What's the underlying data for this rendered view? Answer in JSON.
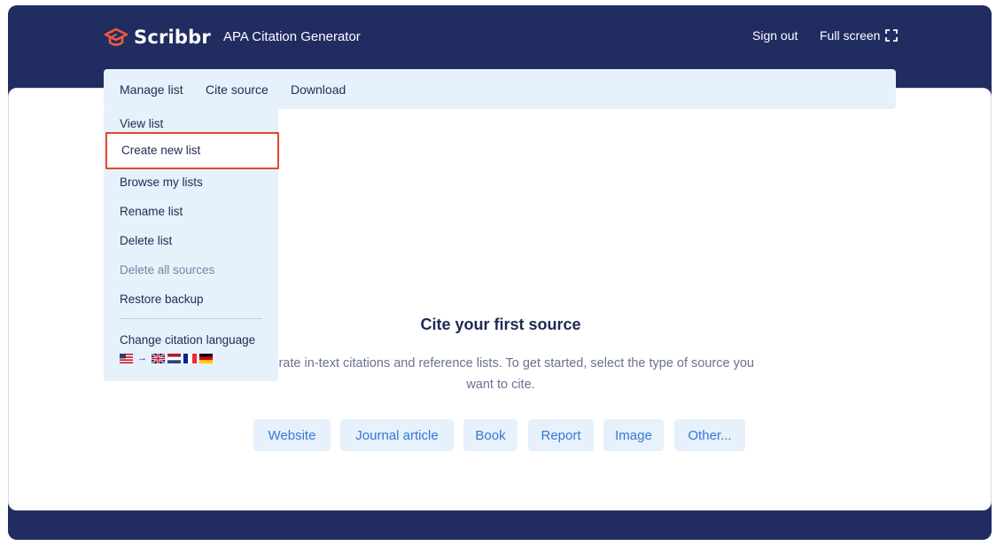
{
  "header": {
    "brand": "Scribbr",
    "app_title": "APA Citation Generator",
    "sign_out": "Sign out",
    "full_screen": "Full screen"
  },
  "toolbar": {
    "manage_list": "Manage list",
    "cite_source": "Cite source",
    "download": "Download"
  },
  "dropdown": {
    "items": [
      {
        "label": "View list"
      },
      {
        "label": "Create new list"
      },
      {
        "label": "Browse my lists"
      },
      {
        "label": "Rename list"
      },
      {
        "label": "Delete list"
      },
      {
        "label": "Delete all sources"
      },
      {
        "label": "Restore backup"
      }
    ],
    "language_label": "Change citation language",
    "flags": [
      "us-flag-icon",
      "arrow-right-icon",
      "uk-flag-icon",
      "nl-flag-icon",
      "fr-flag-icon",
      "de-flag-icon"
    ]
  },
  "main": {
    "title": "Cite your first source",
    "description": "Generate in-text citations and reference lists. To get started, select the type of source you want to cite.",
    "source_types": [
      "Website",
      "Journal article",
      "Book",
      "Report",
      "Image",
      "Other..."
    ]
  },
  "colors": {
    "frame": "#212c60",
    "accent": "#3578d4",
    "panel": "#e6f1fb",
    "highlight": "#e4472e",
    "brand": "#f05a3c"
  }
}
